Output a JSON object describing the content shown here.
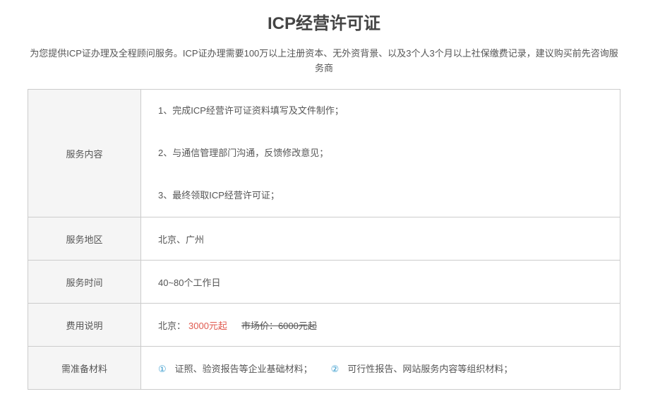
{
  "header": {
    "title": "ICP经营许可证",
    "subtitle": "为您提供ICP证办理及全程顾问服务。ICP证办理需要100万以上注册资本、无外资背景、以及3个人3个月以上社保缴费记录，建议购买前先咨询服务商"
  },
  "table": {
    "content": {
      "label": "服务内容",
      "items": [
        "1、完成ICP经营许可证资料填写及文件制作；",
        "2、与通信管理部门沟通，反馈修改意见；",
        "3、最终领取ICP经营许可证；"
      ]
    },
    "region": {
      "label": "服务地区",
      "value": "北京、广州"
    },
    "time": {
      "label": "服务时间",
      "value": "40~80个工作日"
    },
    "fee": {
      "label": "费用说明",
      "city": "北京：",
      "price": "3000元起",
      "market_price": "市场价：6000元起",
      "price_color": "#e05a4f"
    },
    "materials": {
      "label": "需准备材料",
      "items": [
        {
          "num": "①",
          "text": "证照、验资报告等企业基础材料；"
        },
        {
          "num": "②",
          "text": "可行性报告、网站服务内容等组织材料；"
        }
      ]
    }
  }
}
